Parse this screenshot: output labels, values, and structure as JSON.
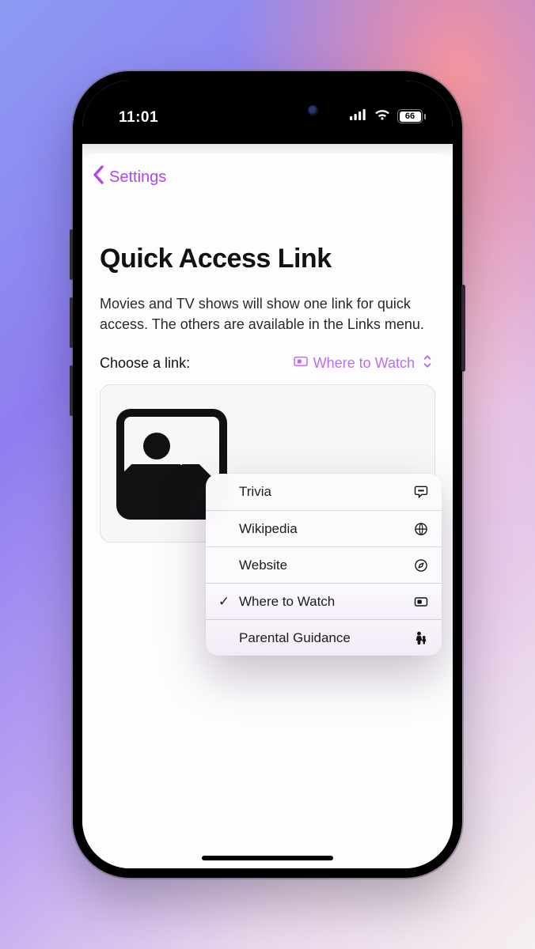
{
  "status": {
    "time": "11:01",
    "battery": "66"
  },
  "nav": {
    "back_label": "Settings"
  },
  "page": {
    "title": "Quick Access Link",
    "description": "Movies and TV shows will show one link for quick access. The others are available in the Links menu.",
    "choose_label": "Choose a link:"
  },
  "picker": {
    "selected_label": "Where to Watch"
  },
  "menu": {
    "selected_index": 3,
    "items": [
      {
        "label": "Trivia",
        "icon": "trivia-icon"
      },
      {
        "label": "Wikipedia",
        "icon": "globe-icon"
      },
      {
        "label": "Website",
        "icon": "compass-icon"
      },
      {
        "label": "Where to Watch",
        "icon": "watch-icon"
      },
      {
        "label": "Parental Guidance",
        "icon": "family-icon"
      }
    ]
  }
}
